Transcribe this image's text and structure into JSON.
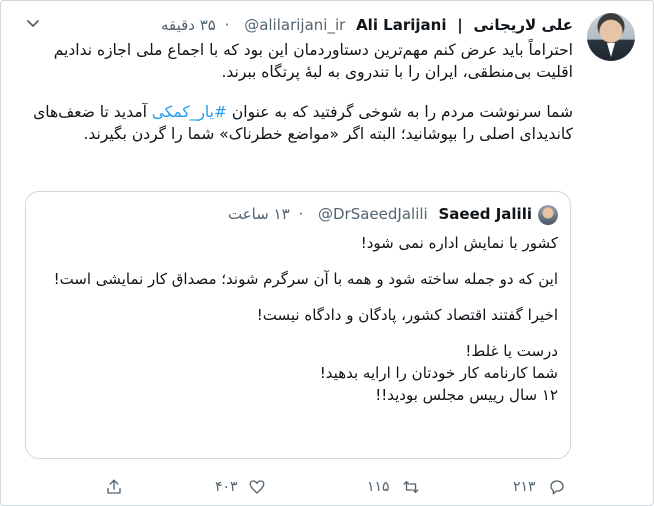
{
  "tweet": {
    "author_name_fa": "علی لاریجانی",
    "separator": "|",
    "author_name_en": "Ali Larijani",
    "handle": "@alilarijani_ir",
    "dot": "·",
    "time": "۳۵ دقیقه",
    "paragraph_1": "احتراماً باید عرض کنم مهم‌ترین دستاوردمان این بود که با اجماع ملی اجازه ندادیم اقلیت بی‌منطقی، ایران را با تندروی به لبهٔ پرتگاه ببرند.",
    "paragraph_2_before": "شما سرنوشت مردم را به شوخی گرفتید که به عنوان ",
    "hashtag": "#یار_کمکی",
    "paragraph_2_after": " آمدید تا ضعف‌های کاندیدای اصلی را بپوشانید؛ البته اگر «مواضع خطرناک» شما را گردن بگیرند."
  },
  "quote": {
    "author_name": "Saeed Jalili",
    "handle": "@DrSaeedJalili",
    "dot": "·",
    "time": "۱۳ ساعت",
    "line_1": "کشور با نمایش اداره نمی شود!",
    "line_2": "این که دو جمله ساخته شود و همه با آن سرگرم شوند؛ مصداق کار نمایشی است!",
    "line_3": "اخیرا گفتند اقتصاد کشور، پادگان و دادگاه نیست!",
    "line_4": "درست یا غلط!",
    "line_5": "شما کارنامه کار خودتان را ارایه بدهید!",
    "line_6": "۱۲ سال رییس مجلس بودید!!"
  },
  "actions": {
    "reply_count": "۲۱۳",
    "retweet_count": "۱۱۵",
    "like_count": "۴۰۳"
  },
  "icons": {
    "more": "chevron-down-icon",
    "reply": "reply-icon",
    "retweet": "retweet-icon",
    "like": "heart-icon",
    "share": "share-icon"
  },
  "colors": {
    "hashtag": "#1d9bf0",
    "secondary_text": "#536471",
    "border": "#cfd9de"
  }
}
